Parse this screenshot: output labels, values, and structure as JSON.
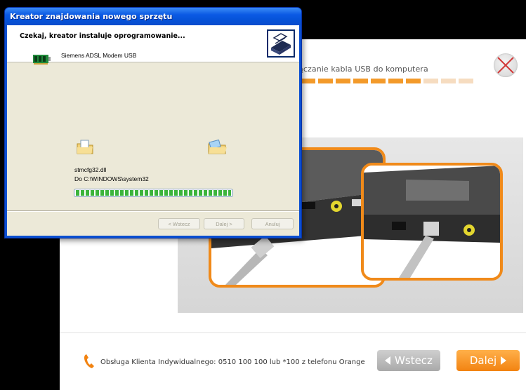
{
  "app": {
    "step_title": "Podłączanie kabla USB do komputera",
    "step_title_visible": "ączanie kabla USB do komputera",
    "progress": {
      "total_segments": 10,
      "filled_segments": 7
    },
    "support_text": "Obsługa Klienta Indywidualnego: 0510 100 100 lub *100 z telefonu Orange",
    "back_label": "Wstecz",
    "next_label": "Dalej",
    "colors": {
      "accent": "#f28311",
      "back_button": "#b5b5b5"
    }
  },
  "wizard": {
    "title": "Kreator znajdowania nowego sprzętu",
    "header_text": "Czekaj, kreator instaluje oprogramowanie...",
    "device_name": "Siemens ADSL Modem USB",
    "file_name": "stmcfg32.dll",
    "destination": "Do C:\\WINDOWS\\system32",
    "copy_progress_percent": 100,
    "buttons": {
      "back": "< Wstecz",
      "next": "Dalej >",
      "cancel": "Anuluj"
    }
  }
}
